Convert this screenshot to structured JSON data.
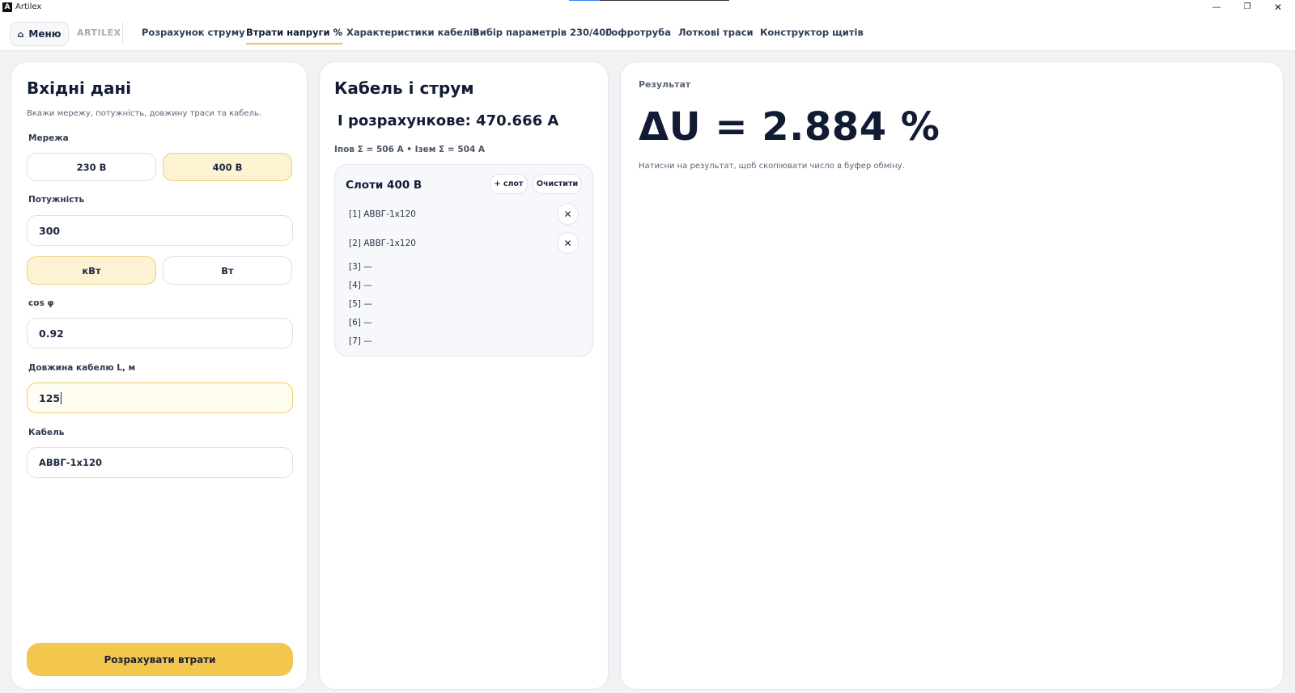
{
  "window": {
    "title": "Artilex",
    "logo_letter": "A",
    "minimize": "—",
    "maximize": "❐",
    "close": "✕"
  },
  "nav": {
    "menu_icon": "⌂",
    "menu_label": "Меню",
    "brand": "ARTILEX",
    "tabs": [
      {
        "label": "Розрахунок струму"
      },
      {
        "label": "Втрати напруги %"
      },
      {
        "label": "Характеристики кабелів"
      },
      {
        "label": "Вибір параметрів 230/400"
      },
      {
        "label": "Гофротруба"
      },
      {
        "label": "Лоткові траси"
      },
      {
        "label": "Конструктор щитів"
      }
    ],
    "active_tab": "Втрати напруги %"
  },
  "input_panel": {
    "title": "Вхідні дані",
    "subtitle": "Вкажи мережу, потужність, довжину траси та кабель.",
    "network_label": "Мережа",
    "network_options": [
      "230 В",
      "400 В"
    ],
    "network_selected": "400 В",
    "power_label": "Потужність",
    "power_value": "300",
    "power_units": [
      "кВт",
      "Вт"
    ],
    "power_unit_selected": "кВт",
    "cos_label": "cos φ",
    "cos_value": "0.92",
    "length_label": "Довжина кабелю L, м",
    "length_value": "125",
    "cable_label": "Кабель",
    "cable_value": "АВВГ-1x120",
    "calculate_button": "Розрахувати втрати"
  },
  "cable_panel": {
    "title": "Кабель і струм",
    "current_line": "I розрахункове: 470.666 A",
    "sum_line": "Iпов Σ = 506 A   •   Iзем Σ = 504 A",
    "slots": {
      "title": "Слоти 400 В",
      "add_button": "+ слот",
      "clear_button": "Очистити",
      "remove_icon": "✕",
      "rows": [
        {
          "label": "[1] АВВГ-1x120"
        },
        {
          "label": "[2] АВВГ-1x120"
        },
        {
          "label": "[3] —"
        },
        {
          "label": "[4] —"
        },
        {
          "label": "[5] —"
        },
        {
          "label": "[6] —"
        },
        {
          "label": "[7] —"
        }
      ]
    }
  },
  "result_panel": {
    "label": "Результат",
    "value": "ΔU = 2.884 %",
    "hint": "Натисни на результат, щоб скопіювати число в буфер обміну."
  },
  "colors": {
    "accent": "#f3c64e",
    "selected_bg": "#fdf3d3",
    "text_dark": "#121d35"
  }
}
